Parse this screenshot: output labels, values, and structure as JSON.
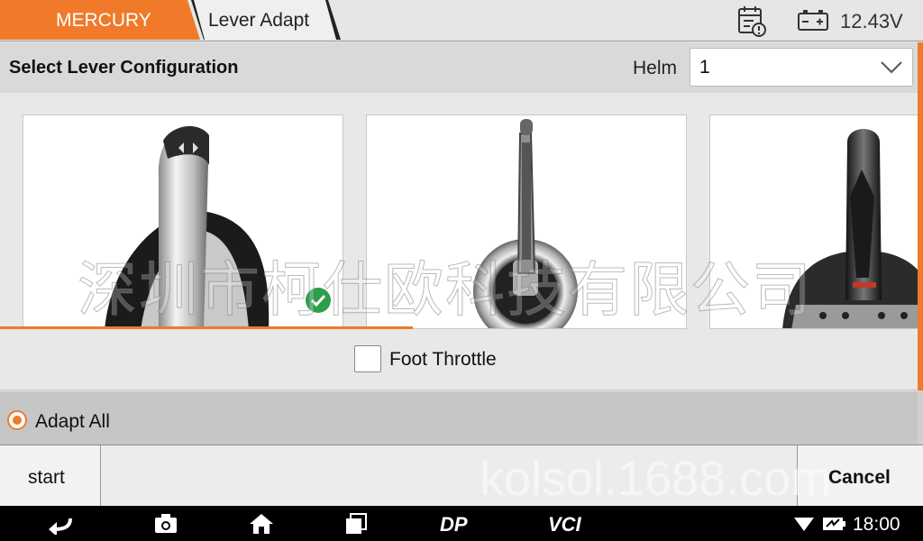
{
  "breadcrumb": {
    "items": [
      {
        "label": "MERCURY"
      },
      {
        "label": "Lever Adapt"
      }
    ]
  },
  "status": {
    "voltage": "12.43V",
    "icons": [
      "calendar-alert-icon",
      "battery-icon"
    ]
  },
  "header": {
    "title": "Select Lever Configuration",
    "helm_label": "Helm",
    "helm_value": "1"
  },
  "gallery": {
    "levers": [
      {
        "name": "lever-option-1",
        "selected": true
      },
      {
        "name": "lever-option-2",
        "selected": false
      },
      {
        "name": "lever-option-3",
        "selected": false
      }
    ]
  },
  "options": {
    "foot_throttle_label": "Foot Throttle",
    "foot_throttle_checked": false,
    "adapt_all_label": "Adapt All",
    "adapt_all_selected": true
  },
  "actions": {
    "start_label": "start",
    "cancel_label": "Cancel"
  },
  "navbar": {
    "dp_label": "DP",
    "vci_label": "VCI",
    "time": "18:00"
  },
  "watermarks": {
    "chinese": "深圳市柯仕欧科技有限公司",
    "url": "kolsol.1688.com"
  },
  "colors": {
    "accent": "#f07a2a",
    "check_green": "#2e9e4a"
  }
}
